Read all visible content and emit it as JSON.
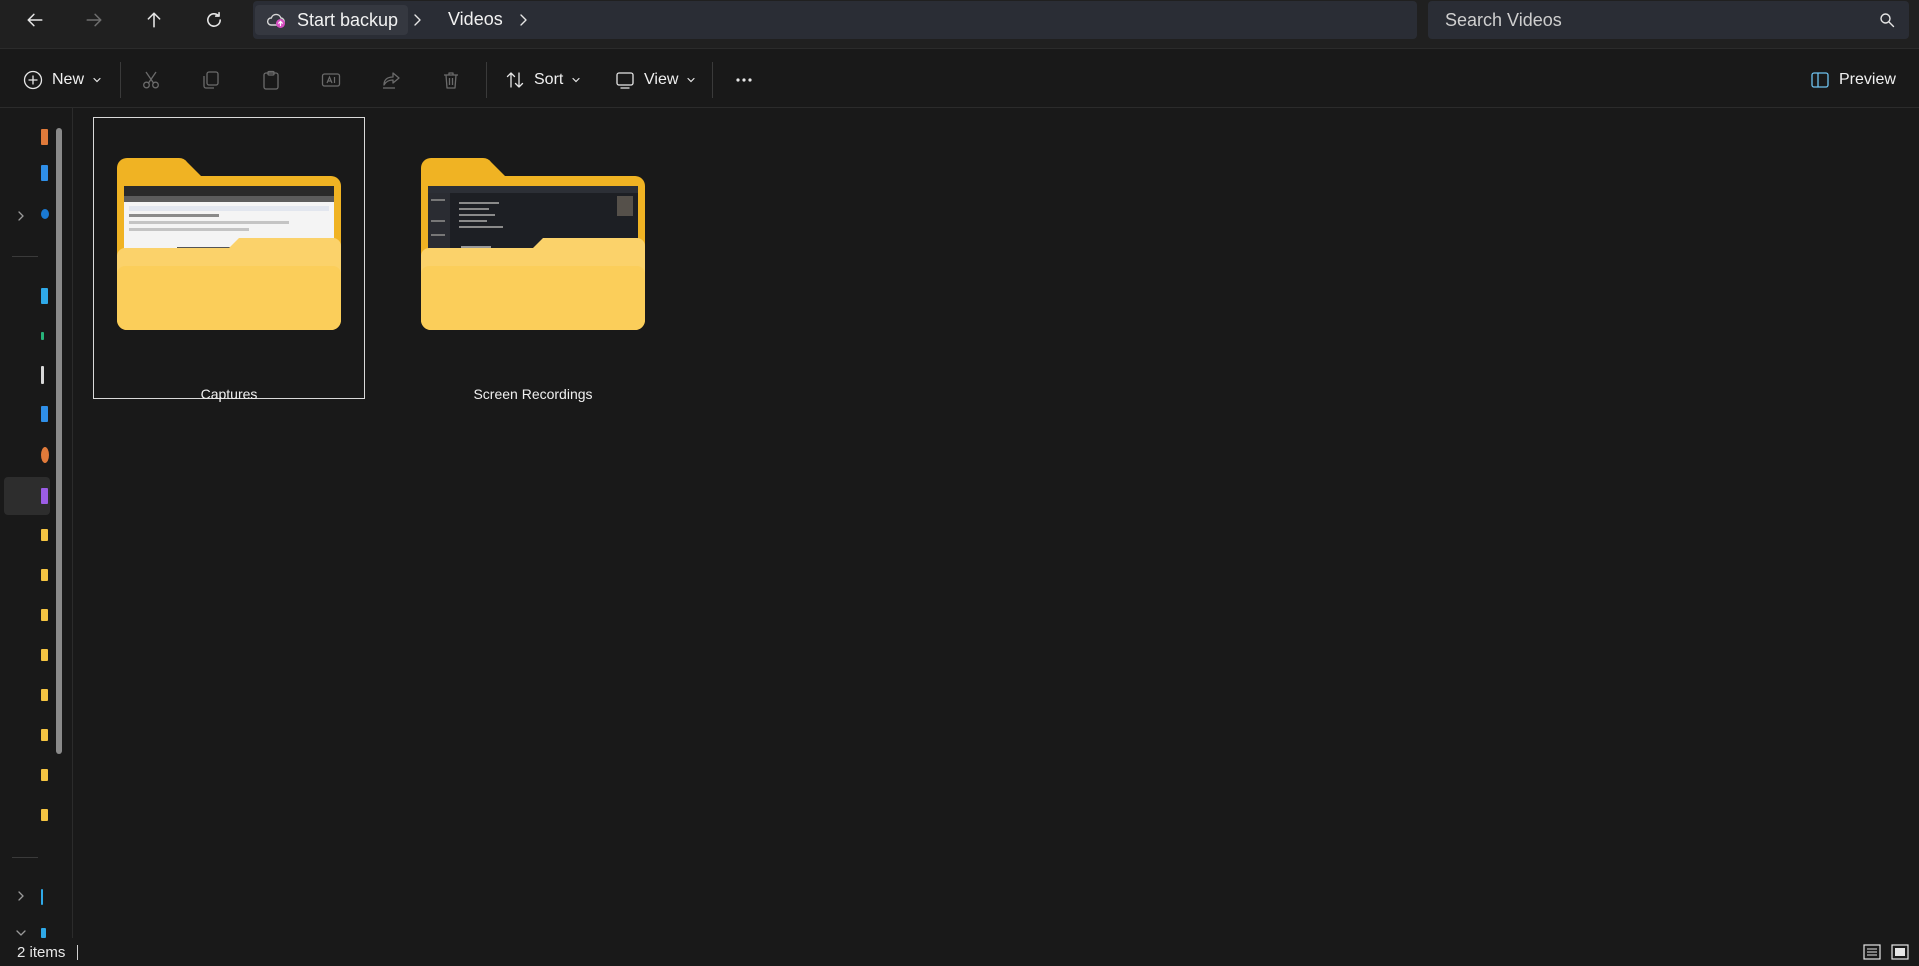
{
  "window": {
    "title": "Videos"
  },
  "navigation": {
    "back_label": "Back",
    "forward_label": "Forward",
    "up_label": "Up",
    "refresh_label": "Refresh"
  },
  "address": {
    "backup_chip": "Start backup",
    "crumbs": [
      "Videos"
    ]
  },
  "search": {
    "placeholder": "Search Videos"
  },
  "commands": {
    "new_label": "New",
    "sort_label": "Sort",
    "view_label": "View",
    "preview_label": "Preview",
    "icons": [
      "cut-icon",
      "copy-icon",
      "paste-icon",
      "rename-icon",
      "share-icon",
      "delete-icon",
      "more-icon"
    ]
  },
  "items": [
    {
      "name": "Captures",
      "selected": true
    },
    {
      "name": "Screen Recordings",
      "selected": false
    }
  ],
  "status": {
    "item_count": "2 items"
  },
  "colors": {
    "accent_folder": "#f7c234",
    "background": "#191919",
    "toolbar": "#202020",
    "address": "#2a2d35"
  }
}
